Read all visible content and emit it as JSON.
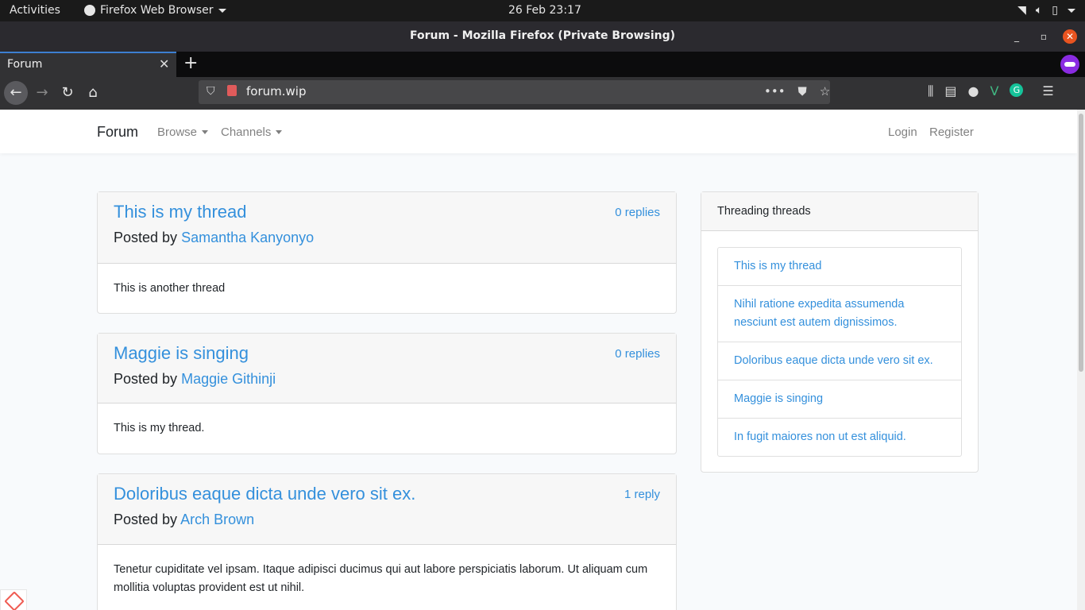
{
  "gnome": {
    "activities": "Activities",
    "app_menu": "Firefox Web Browser",
    "clock": "26 Feb  23:17"
  },
  "window": {
    "title": "Forum - Mozilla Firefox (Private Browsing)"
  },
  "tabs": [
    {
      "label": "Forum"
    }
  ],
  "urlbar": {
    "url": "forum.wip"
  },
  "site_nav": {
    "brand": "Forum",
    "browse": "Browse",
    "channels": "Channels",
    "login": "Login",
    "register": "Register"
  },
  "threads": [
    {
      "title": "This is my thread",
      "replies": "0 replies",
      "posted_by": "Posted by",
      "author": "Samantha Kanyonyo",
      "body": "This is another thread"
    },
    {
      "title": "Maggie is singing",
      "replies": "0 replies",
      "posted_by": "Posted by",
      "author": "Maggie Githinji",
      "body": "This is my thread."
    },
    {
      "title": "Doloribus eaque dicta unde vero sit ex.",
      "replies": "1 reply",
      "posted_by": "Posted by",
      "author": "Arch Brown",
      "body": "Tenetur cupiditate vel ipsam. Itaque adipisci ducimus qui aut labore perspiciatis laborum. Ut aliquam cum mollitia voluptas provident est ut nihil."
    }
  ],
  "sidebar": {
    "title": "Threading threads",
    "items": [
      "This is my thread",
      "Nihil ratione expedita assumenda nesciunt est autem dignissimos.",
      "Doloribus eaque dicta unde vero sit ex.",
      "Maggie is singing",
      "In fugit maiores non ut est aliquid."
    ]
  },
  "colors": {
    "link": "#3490dc",
    "page_bg": "#f8fafc",
    "tab_accent": "#3d7fd1",
    "private_purple": "#8a2be2",
    "close_orange": "#e95420"
  }
}
